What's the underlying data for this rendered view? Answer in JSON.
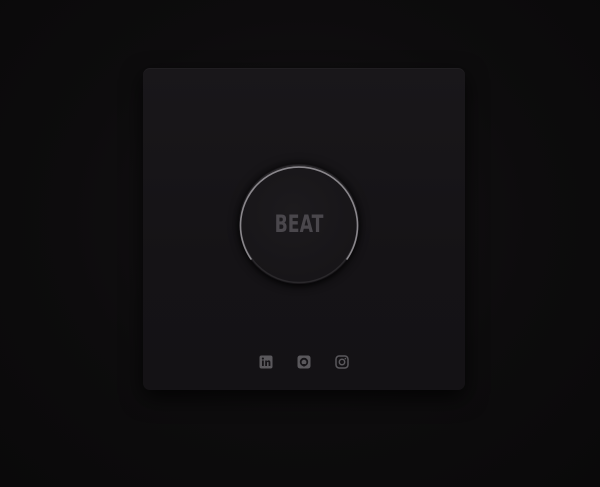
{
  "beat_button": {
    "label": "BEAT"
  },
  "social_links": [
    {
      "icon": "linkedin-icon"
    },
    {
      "icon": "github-icon"
    },
    {
      "icon": "instagram-icon"
    }
  ],
  "colors": {
    "background": "#0c0b0c",
    "card": "#171518",
    "label": "#4a474c",
    "ring": "#8a878c",
    "icons": "#5a585c"
  }
}
